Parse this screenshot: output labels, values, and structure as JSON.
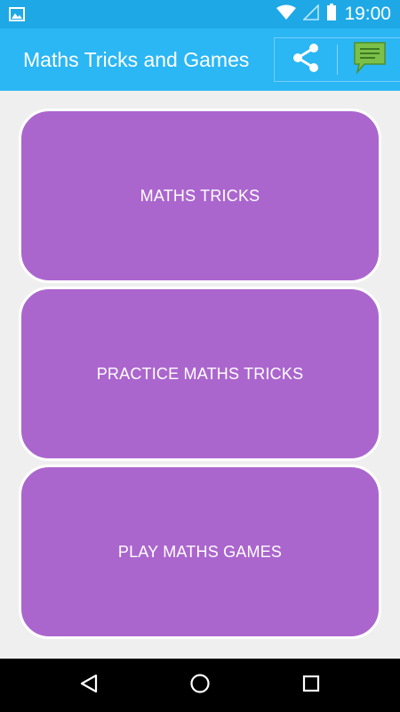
{
  "status_bar": {
    "time": "19:00",
    "icons": [
      "image-notification-icon",
      "wifi-icon",
      "signal-icon",
      "battery-icon"
    ]
  },
  "app_bar": {
    "title": "Maths Tricks and Games",
    "actions": [
      "share-icon",
      "feedback-icon"
    ]
  },
  "menu": {
    "items": [
      {
        "label": "MATHS TRICKS"
      },
      {
        "label": "PRACTICE MATHS TRICKS"
      },
      {
        "label": "PLAY MATHS GAMES"
      }
    ]
  },
  "nav_bar": {
    "buttons": [
      "back-icon",
      "home-icon",
      "recents-icon"
    ]
  },
  "colors": {
    "status_bar": "#1ea9e6",
    "app_bar": "#2bb6f4",
    "button_fill": "#ab66ce",
    "background": "#efefef",
    "feedback_icon": "#7cc04a"
  }
}
